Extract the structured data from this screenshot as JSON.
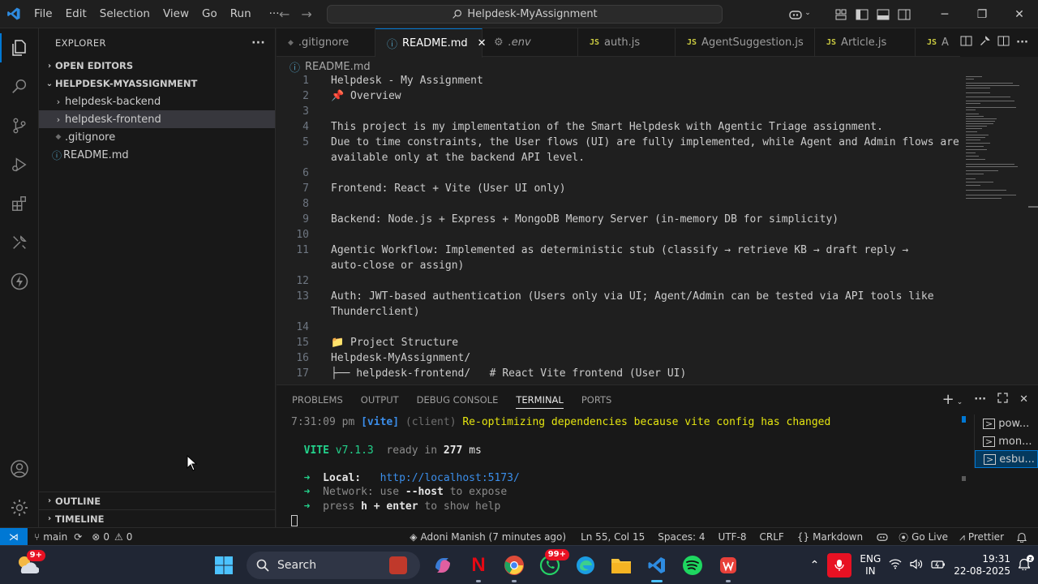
{
  "titlebar": {
    "menu": [
      "File",
      "Edit",
      "Selection",
      "View",
      "Go",
      "Run"
    ],
    "more": "···",
    "command_center": "Helpdesk-MyAssignment"
  },
  "sidebar": {
    "title": "EXPLORER",
    "more": "···",
    "open_editors": "OPEN EDITORS",
    "workspace": "HELPDESK-MYASSIGNMENT",
    "tree": [
      {
        "label": "helpdesk-backend",
        "type": "folder"
      },
      {
        "label": "helpdesk-frontend",
        "type": "folder"
      },
      {
        "label": ".gitignore",
        "type": "file"
      },
      {
        "label": "README.md",
        "type": "file"
      }
    ],
    "outline": "OUTLINE",
    "timeline": "TIMELINE"
  },
  "tabs": [
    {
      "label": ".gitignore",
      "icon": "git"
    },
    {
      "label": "README.md",
      "icon": "info",
      "active": true
    },
    {
      "label": ".env",
      "icon": "gear"
    },
    {
      "label": "auth.js",
      "icon": "js"
    },
    {
      "label": "AgentSuggestion.js",
      "icon": "js"
    },
    {
      "label": "Article.js",
      "icon": "js"
    },
    {
      "label": "A",
      "icon": "js"
    }
  ],
  "breadcrumb": "README.md",
  "editor": {
    "lines": [
      {
        "n": "1",
        "text": "Helpdesk - My Assignment"
      },
      {
        "n": "2",
        "text": "📌 Overview"
      },
      {
        "n": "3",
        "text": ""
      },
      {
        "n": "4",
        "text": "This project is my implementation of the Smart Helpdesk with Agentic Triage assignment."
      },
      {
        "n": "5",
        "text": "Due to time constraints, the User flows (UI) are fully implemented, while Agent and Admin flows are"
      },
      {
        "n": "",
        "text": "available only at the backend API level."
      },
      {
        "n": "6",
        "text": ""
      },
      {
        "n": "7",
        "text": "Frontend: React + Vite (User UI only)"
      },
      {
        "n": "8",
        "text": ""
      },
      {
        "n": "9",
        "text": "Backend: Node.js + Express + MongoDB Memory Server (in-memory DB for simplicity)"
      },
      {
        "n": "10",
        "text": ""
      },
      {
        "n": "11",
        "text": "Agentic Workflow: Implemented as deterministic stub (classify → retrieve KB → draft reply →"
      },
      {
        "n": "",
        "text": "auto-close or assign)"
      },
      {
        "n": "12",
        "text": ""
      },
      {
        "n": "13",
        "text": "Auth: JWT-based authentication (Users only via UI; Agent/Admin can be tested via API tools like"
      },
      {
        "n": "",
        "text": "Thunderclient)"
      },
      {
        "n": "14",
        "text": ""
      },
      {
        "n": "15",
        "text": "📁 Project Structure"
      },
      {
        "n": "16",
        "text": "Helpdesk-MyAssignment/"
      },
      {
        "n": "17",
        "text": "├── helpdesk-frontend/   # React Vite frontend (User UI)"
      }
    ]
  },
  "panel": {
    "tabs": [
      "PROBLEMS",
      "OUTPUT",
      "DEBUG CONSOLE",
      "TERMINAL",
      "PORTS"
    ],
    "active_tab": "TERMINAL",
    "terminal": {
      "time": "7:31:09 pm",
      "vite_tag": "[vite]",
      "client": "(client)",
      "message": "Re-optimizing dependencies because vite config has changed",
      "vite_name": "VITE",
      "vite_version": "v7.1.3",
      "ready_text": "ready in",
      "ready_ms": "277",
      "ready_unit": "ms",
      "arrow": "➜",
      "local_label": "Local:",
      "local_url": "http://localhost:5173/",
      "network_label": "Network:",
      "network_pre": "use",
      "network_flag": "--host",
      "network_post": "to expose",
      "help_pre": "press",
      "help_key": "h + enter",
      "help_post": "to show help"
    },
    "terminals": [
      {
        "label": "pow..."
      },
      {
        "label": "mon..."
      },
      {
        "label": "esbu...",
        "active": true
      }
    ]
  },
  "statusbar": {
    "branch": "main",
    "errors": "0",
    "warnings": "0",
    "blame": "Adoni Manish (7 minutes ago)",
    "position": "Ln 55, Col 15",
    "spaces": "Spaces: 4",
    "encoding": "UTF-8",
    "eol": "CRLF",
    "language": "Markdown",
    "golive": "Go Live",
    "prettier": "Prettier"
  },
  "taskbar": {
    "weather_badge": "9+",
    "search": "Search",
    "whatsapp_badge": "99+",
    "language": "ENG",
    "region": "IN",
    "time": "19:31",
    "date": "22-08-2025"
  },
  "colors": {
    "accent": "#0078d4",
    "editor_bg": "#1f1f1f",
    "sidebar_bg": "#181818",
    "terminal_green": "#23d18b",
    "terminal_link": "#3b8eea",
    "vite_tag": "#3b8eea"
  }
}
